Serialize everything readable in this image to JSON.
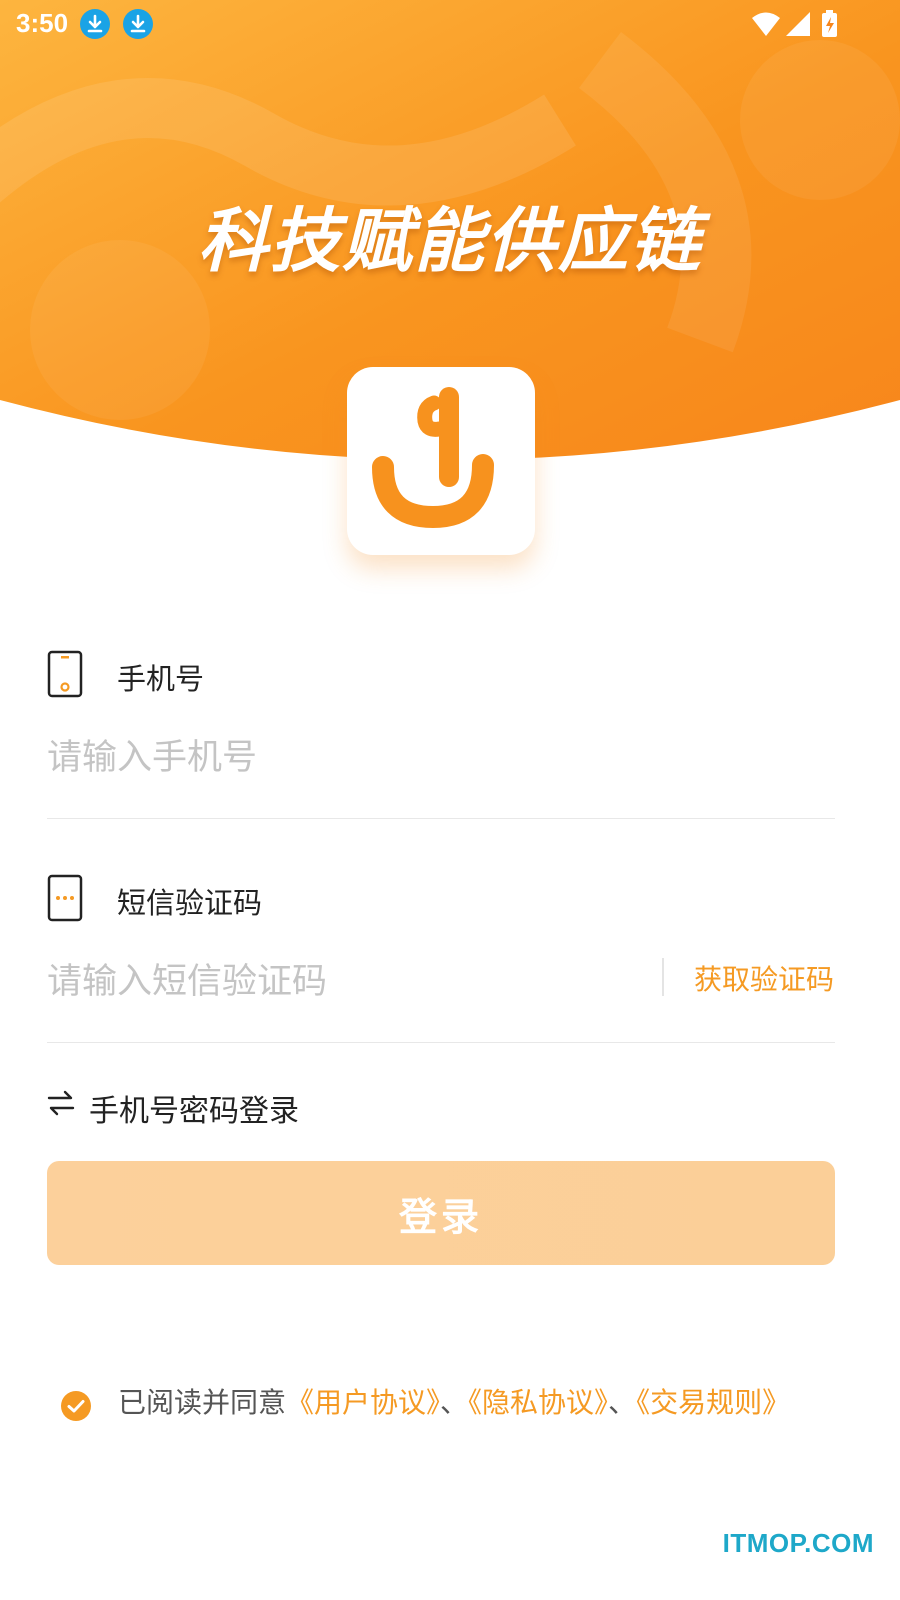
{
  "status_bar": {
    "time": "3:50",
    "notification_icons": [
      "download-icon",
      "download-icon"
    ],
    "right_icons": [
      "wifi-icon",
      "signal-icon",
      "battery-charging-icon"
    ]
  },
  "hero": {
    "title": "科技赋能供应链",
    "gradient_colors": [
      "#fdb53f",
      "#f7861b"
    ]
  },
  "form": {
    "phone": {
      "label": "手机号",
      "placeholder": "请输入手机号",
      "icon": "phone-icon"
    },
    "sms": {
      "label": "短信验证码",
      "placeholder": "请输入短信验证码",
      "icon": "sms-icon",
      "get_code_label": "获取验证码"
    },
    "switch_mode_label": "手机号密码登录",
    "login_button_label": "登录"
  },
  "agreement": {
    "checked": true,
    "prefix": "已阅读并同意",
    "link_user": "《用户协议》",
    "separator_1": "、",
    "link_privacy": "《隐私协议》",
    "separator_2": "、",
    "link_trade": "《交易规则》"
  },
  "watermark": "ITMOP.COM",
  "colors": {
    "accent": "#f59a23",
    "button_disabled": "#fcd09b",
    "placeholder": "#c4c4c4"
  }
}
